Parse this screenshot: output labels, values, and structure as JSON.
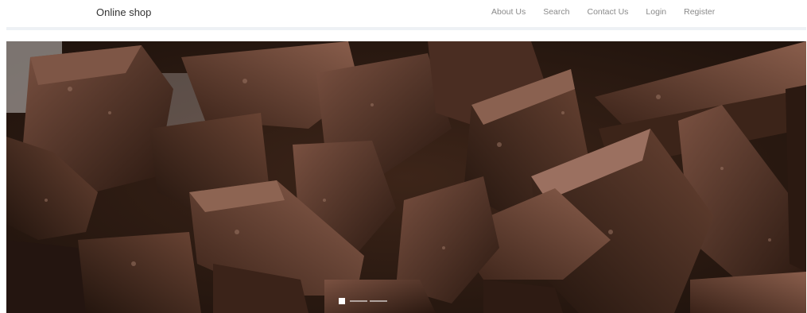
{
  "navbar": {
    "brand": "Online shop",
    "links": [
      {
        "label": "About Us"
      },
      {
        "label": "Search"
      },
      {
        "label": "Contact Us"
      },
      {
        "label": "Login"
      },
      {
        "label": "Register"
      }
    ]
  },
  "carousel": {
    "slide_count": 3,
    "active_index": 0,
    "image_subject": "dark chocolate chunks"
  },
  "colors": {
    "hero_base": "#2b1a13",
    "chocolate_light": "#6b4636",
    "chocolate_dark": "#1c100b",
    "nav_text": "#8a8a8a",
    "brand_text": "#333333"
  }
}
